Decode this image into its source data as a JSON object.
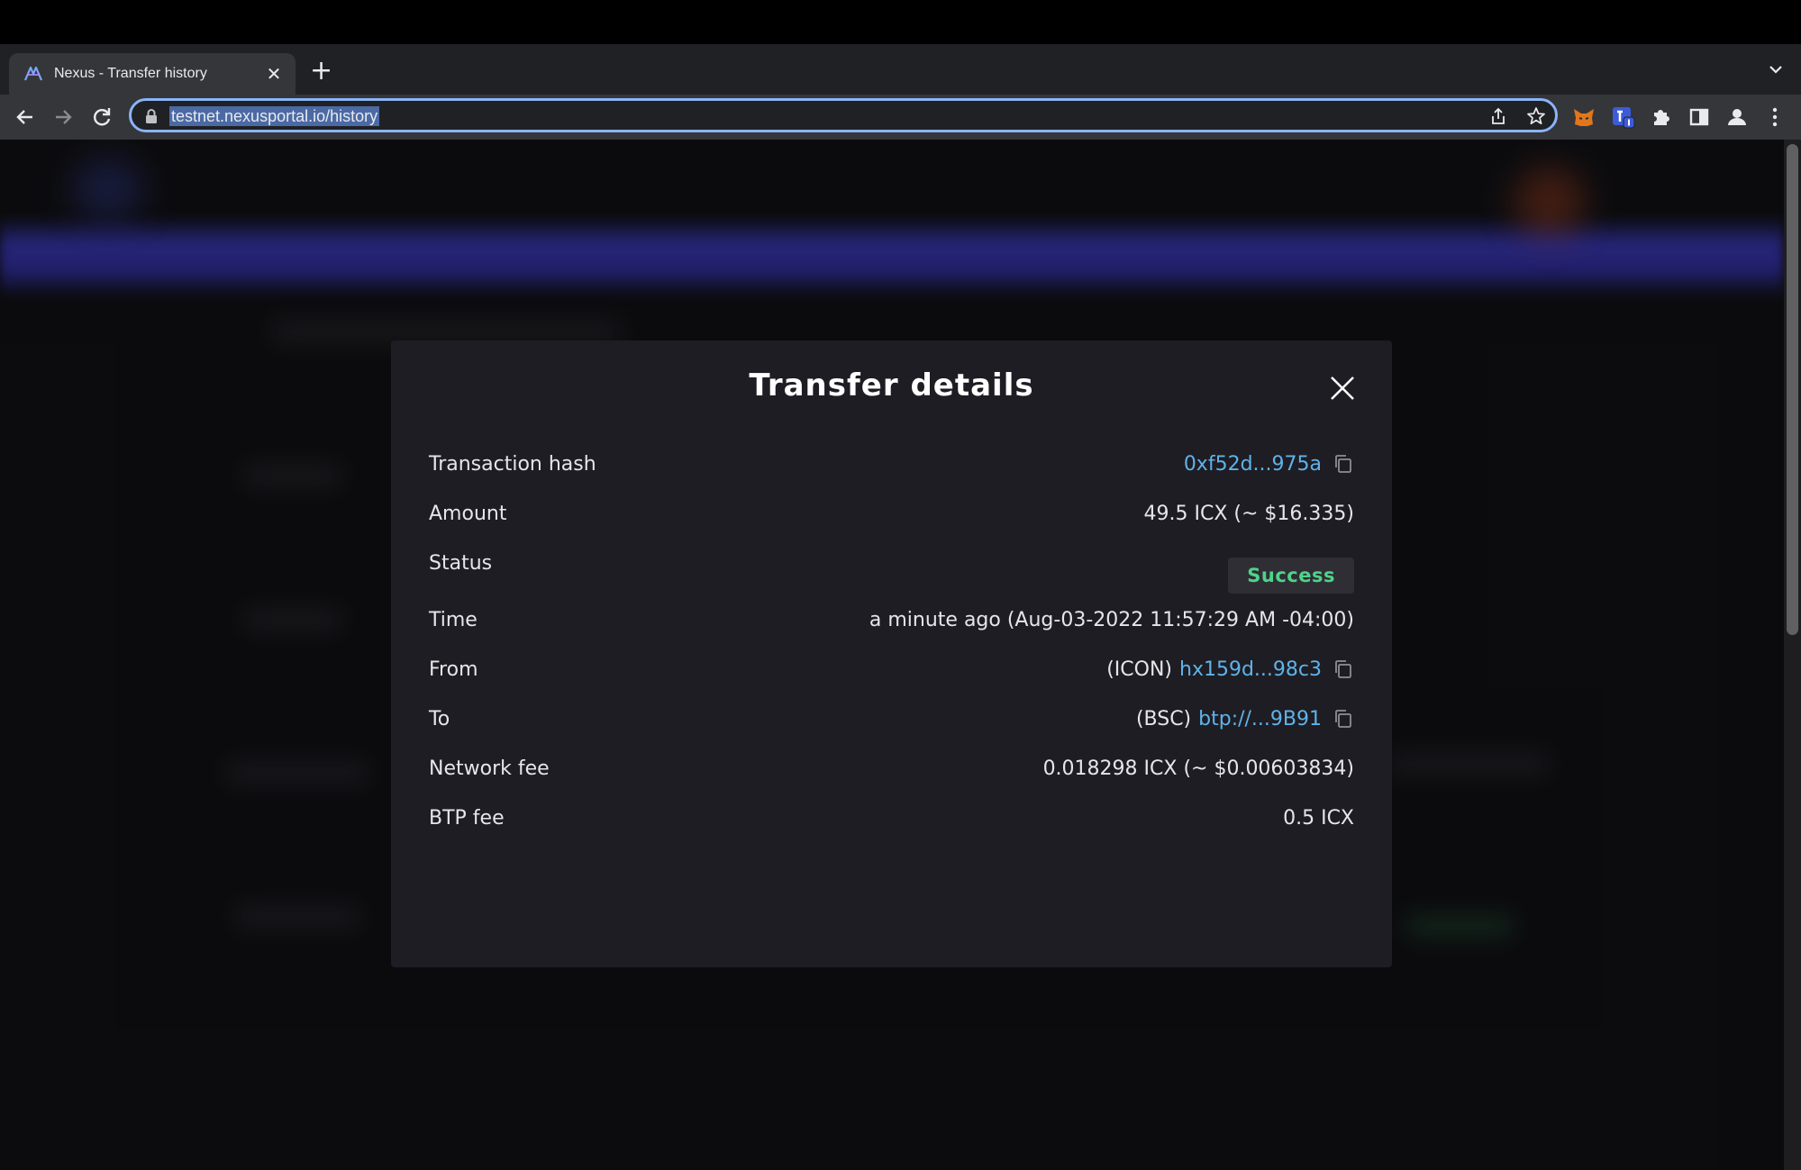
{
  "browser": {
    "tab": {
      "title": "Nexus - Transfer history",
      "close_glyph": "✕"
    },
    "new_tab_glyph": "+",
    "url": "testnet.nexusportal.io/history",
    "icons": [
      "back-icon",
      "forward-icon",
      "reload-icon",
      "lock-icon",
      "share-icon",
      "star-icon",
      "metamask-extension-icon",
      "hana-wallet-extension-icon",
      "extensions-puzzle-icon",
      "side-panel-icon",
      "profile-icon",
      "more-menu-icon",
      "tab-list-chevron-icon"
    ]
  },
  "modal": {
    "title": "Transfer details",
    "rows": {
      "tx_hash": {
        "label": "Transaction hash",
        "value": "0xf52d...975a"
      },
      "amount": {
        "label": "Amount",
        "value": "49.5 ICX (~ $16.335)"
      },
      "status": {
        "label": "Status",
        "value": "Success"
      },
      "time": {
        "label": "Time",
        "value": "a minute ago (Aug-03-2022 11:57:29 AM -04:00)"
      },
      "from": {
        "label": "From",
        "network": "(ICON)",
        "address": "hx159d...98c3"
      },
      "to": {
        "label": "To",
        "network": "(BSC)",
        "address": "btp://...9B91"
      },
      "network_fee": {
        "label": "Network fee",
        "value": "0.018298 ICX (~ $0.00603834)"
      },
      "btp_fee": {
        "label": "BTP fee",
        "value": "0.5 ICX"
      }
    }
  },
  "colors": {
    "link": "#5fb3ea",
    "success": "#4fd38a",
    "modal_bg": "#1e1d23",
    "accent_band": "#3a39b8",
    "omnibox_focus": "#8ab4f8"
  }
}
